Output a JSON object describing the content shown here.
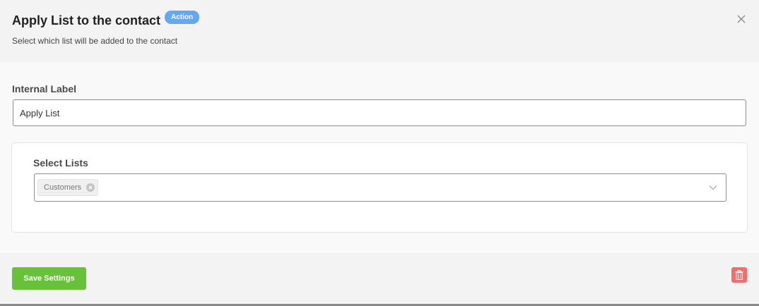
{
  "header": {
    "title": "Apply List to the contact",
    "badge": "Action",
    "subtitle": "Select which list will be added to the contact",
    "close_icon": "close-icon"
  },
  "form": {
    "internal_label": {
      "label": "Internal Label",
      "value": "Apply List"
    },
    "select_lists": {
      "label": "Select Lists",
      "selected": [
        "Customers"
      ],
      "dropdown_icon": "chevron-down-icon"
    }
  },
  "footer": {
    "save_label": "Save Settings",
    "delete_icon": "trash-icon"
  },
  "colors": {
    "badge": "#63a8f5",
    "save_button": "#67c23a",
    "delete_button": "#f56c6c"
  }
}
